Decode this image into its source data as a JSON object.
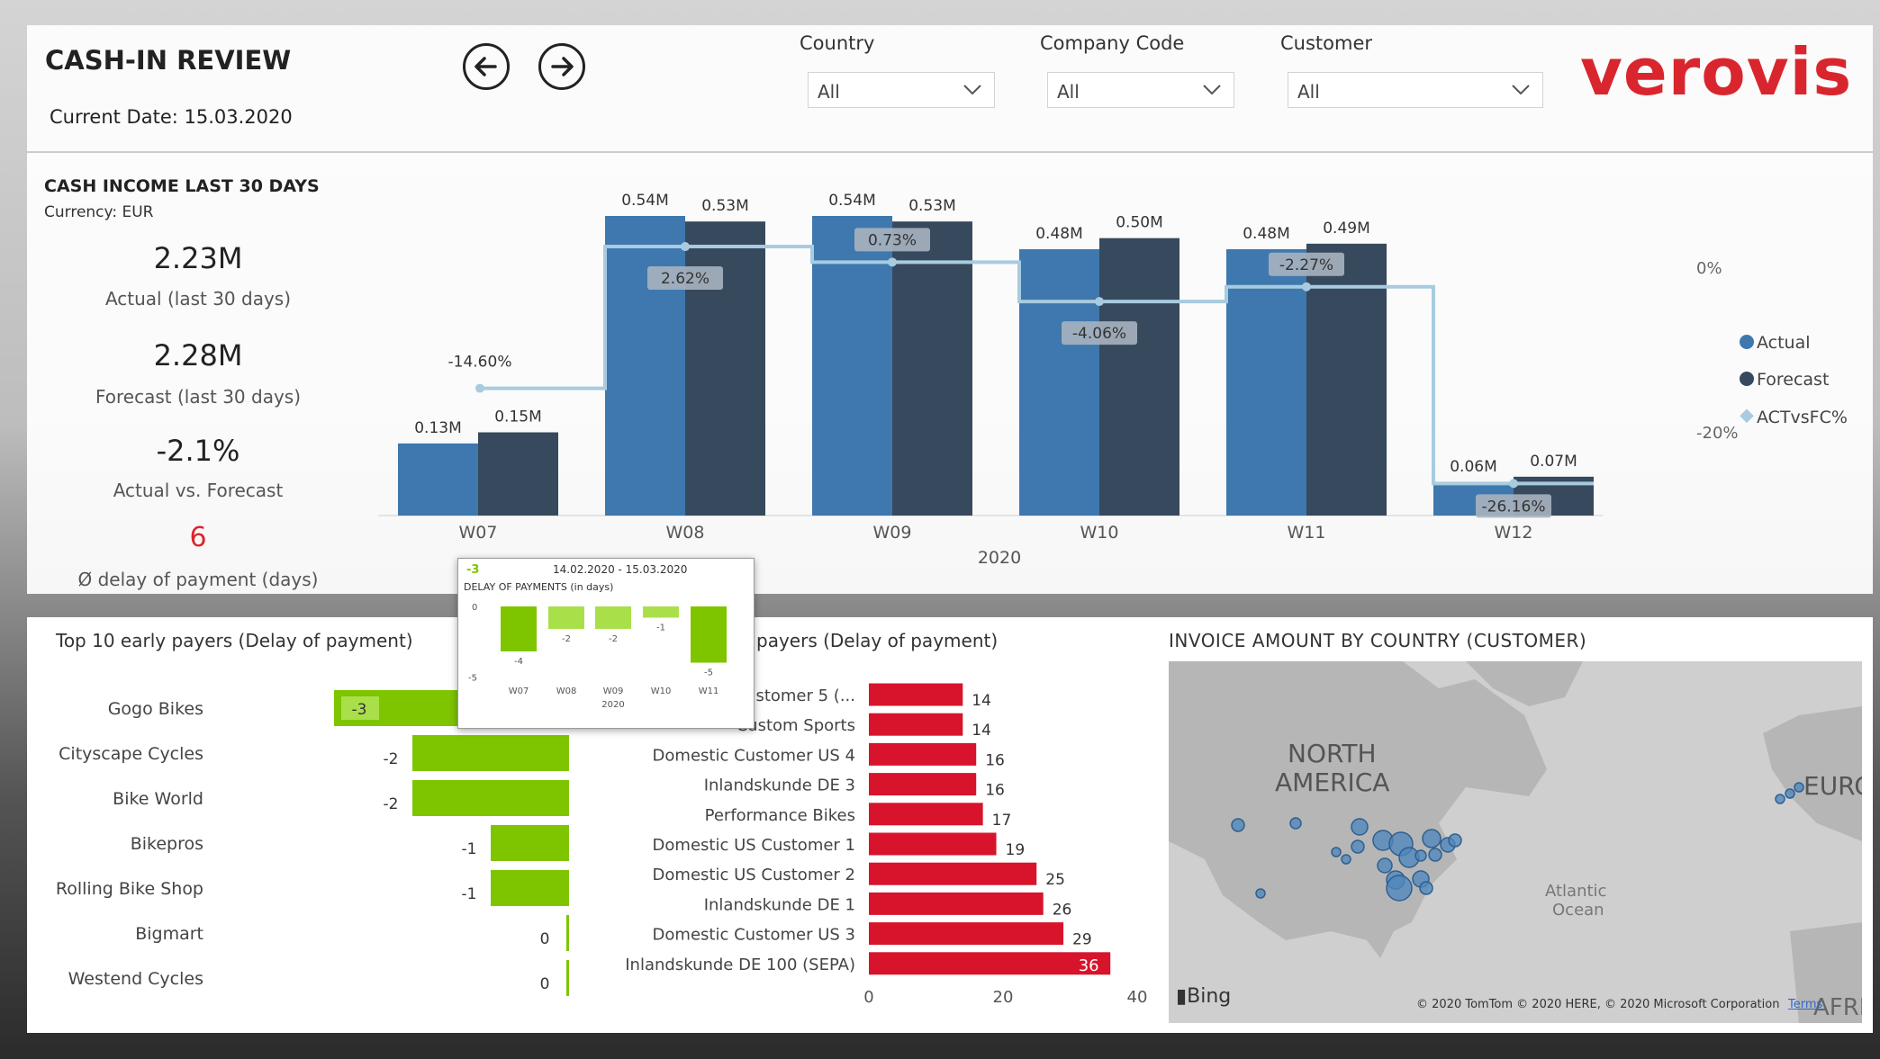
{
  "header": {
    "title": "CASH-IN REVIEW",
    "current_date": "Current Date: 15.03.2020",
    "logo_text": "verovis",
    "brand_color": "#d9262e",
    "filters": [
      {
        "label": "Country",
        "value": "All"
      },
      {
        "label": "Company Code",
        "value": "All"
      },
      {
        "label": "Customer",
        "value": "All"
      }
    ]
  },
  "kpis": {
    "title": "CASH INCOME LAST 30 DAYS",
    "currency": "Currency: EUR",
    "actual_value": "2.23M",
    "actual_label": "Actual (last 30 days)",
    "forecast_value": "2.28M",
    "forecast_label": "Forecast (last 30 days)",
    "variance_value": "-2.1%",
    "variance_label": "Actual vs. Forecast",
    "delay_value": "6",
    "delay_label": "Ø delay of payment (days)"
  },
  "chart_data": [
    {
      "id": "cash_income",
      "type": "bar",
      "categories": [
        "W07",
        "W08",
        "W09",
        "W10",
        "W11",
        "W12"
      ],
      "x_group_label": "2020",
      "series": [
        {
          "name": "Actual",
          "values": [
            0.13,
            0.54,
            0.54,
            0.48,
            0.48,
            0.06
          ],
          "labels": [
            "0.13M",
            "0.54M",
            "0.54M",
            "0.48M",
            "0.48M",
            "0.06M"
          ],
          "color": "#3e78ae"
        },
        {
          "name": "Forecast",
          "values": [
            0.15,
            0.53,
            0.53,
            0.5,
            0.49,
            0.07
          ],
          "labels": [
            "0.15M",
            "0.53M",
            "0.53M",
            "0.50M",
            "0.49M",
            "0.07M"
          ],
          "color": "#37495c"
        }
      ],
      "line_series": {
        "name": "ACTvsFC%",
        "values": [
          -14.6,
          2.62,
          0.73,
          -4.06,
          -2.27,
          -26.16
        ],
        "labels": [
          "-14.60%",
          "2.62%",
          "0.73%",
          "-4.06%",
          "-2.27%",
          "-26.16%"
        ],
        "color": "#a8cbe0"
      },
      "y2_ticks": [
        "0%",
        "-20%"
      ],
      "legend": "right"
    },
    {
      "id": "delay_tooltip",
      "type": "bar",
      "title": "DELAY OF PAYMENTS (in days)",
      "date_range": "14.02.2020 - 15.03.2020",
      "header_value": "-3",
      "categories": [
        "W07",
        "W08",
        "W09",
        "W10",
        "W11"
      ],
      "x_group_label": "2020",
      "values": [
        -4,
        -2,
        -2,
        -1,
        -5
      ],
      "y_ticks": [
        "0",
        "-5"
      ]
    },
    {
      "id": "early_payers",
      "type": "bar",
      "title": "Top 10 early payers (Delay of payment)",
      "categories": [
        "Gogo Bikes",
        "Cityscape Cycles",
        "Bike World",
        "Bikepros",
        "Rolling Bike Shop",
        "Bigmart",
        "Westend Cycles"
      ],
      "values": [
        -3,
        -2,
        -2,
        -1,
        -1,
        0,
        0
      ],
      "color": "#7ec500"
    },
    {
      "id": "late_payers",
      "type": "bar",
      "title": "payers (Delay of payment)",
      "categories": [
        "Customer 5 (...",
        "Custom Sports",
        "Domestic Customer US 4",
        "Inlandskunde DE 3",
        "Performance Bikes",
        "Domestic US Customer 1",
        "Domestic US Customer 2",
        "Inlandskunde DE 1",
        "Domestic Customer US 3",
        "Inlandskunde DE 100 (SEPA)"
      ],
      "values": [
        14,
        14,
        16,
        16,
        17,
        19,
        25,
        26,
        29,
        36
      ],
      "x_ticks": [
        "0",
        "20",
        "40"
      ],
      "xlim": [
        0,
        40
      ],
      "color": "#d7142b"
    }
  ],
  "map": {
    "title": "INVOICE AMOUNT BY COUNTRY (CUSTOMER)",
    "label_na_1": "NORTH",
    "label_na_2": "AMERICA",
    "label_eu": "EURC",
    "label_ocean_1": "Atlantic",
    "label_ocean_2": "Ocean",
    "label_af": "AFRI",
    "bing": "Bing",
    "copyright": "© 2020 TomTom © 2020 HERE, © 2020 Microsoft Corporation",
    "terms": "Terms"
  },
  "icons": {
    "back": "arrow-left-icon",
    "forward": "arrow-right-icon",
    "dropdown": "chevron-down-icon"
  }
}
